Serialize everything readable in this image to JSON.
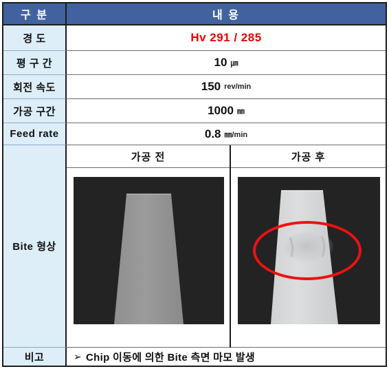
{
  "table": {
    "header": {
      "category_label": "구  분",
      "content_label": "내      용"
    },
    "rows": [
      {
        "label": "경      도",
        "value": "Hv 291 / 285",
        "unit": "",
        "emphasis": "red"
      },
      {
        "label": "평  구  간",
        "value": "10",
        "unit": "㎛",
        "emphasis": "none"
      },
      {
        "label": "회전 속도",
        "value": "150",
        "unit": "rev/min",
        "emphasis": "none"
      },
      {
        "label": "가공 구간",
        "value": "1000",
        "unit": "㎜",
        "emphasis": "none"
      },
      {
        "label": "Feed rate",
        "value": "0.8",
        "unit": "㎜/min",
        "emphasis": "none"
      }
    ],
    "bite_section": {
      "label": "Bite 형상",
      "before_label": "가공 전",
      "after_label": "가공 후",
      "before_image_alt": "bite-before-machining-photo",
      "after_image_alt": "bite-after-machining-photo",
      "annotation_shape": "red-ellipse-wear-marker"
    },
    "remark_row": {
      "label": "비고",
      "bullet": "➢",
      "text": "Chip 이동에 의한 Bite 측면 마모 발생"
    }
  },
  "colors": {
    "header_blue": "#42629f",
    "label_fill": "#ddeef8",
    "accent_red": "#ee0000",
    "marker_red": "#ee1111",
    "photo_background": "#232323",
    "border_dark": "#1c1c1c"
  }
}
